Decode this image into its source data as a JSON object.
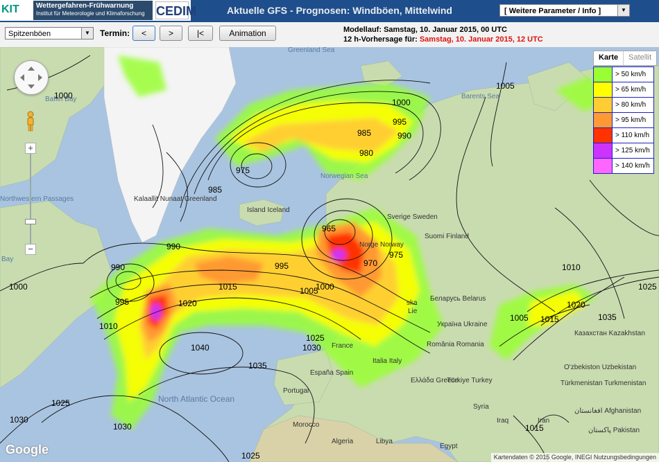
{
  "header": {
    "kit_logo": "KIT",
    "warn_title": "Wettergefahren-Frühwarnung",
    "warn_sub": "Institut für Meteorologie und Klimaforschung",
    "cedim_logo": "CEDIM",
    "title": "Aktuelle GFS - Prognosen: Windböen, Mittelwind",
    "param_select": "[ Weitere Parameter / Info ]"
  },
  "toolbar": {
    "field_select": "Spitzenböen",
    "termin_label": "Termin:",
    "prev_label": "<",
    "next_label": ">",
    "first_label": "|<",
    "animation_label": "Animation",
    "run_prefix": "Modellauf: ",
    "run_value": "Samstag, 10. Januar 2015, 00 UTC",
    "forecast_prefix": "12 h-Vorhersage für: ",
    "forecast_value": "Samstag, 10. Januar 2015, 12 UTC"
  },
  "map": {
    "type_map": "Karte",
    "type_satellite": "Satellit",
    "zoom_in": "+",
    "zoom_out": "−",
    "google": "Google",
    "copyright": "Kartendaten © 2015 Google, INEGI   Nutzungsbedingungen",
    "legend": [
      {
        "label": "> 50 km/h",
        "color": "#99ff33"
      },
      {
        "label": "> 65 km/h",
        "color": "#ffff00"
      },
      {
        "label": "> 80 km/h",
        "color": "#ffcc33"
      },
      {
        "label": "> 95 km/h",
        "color": "#ff9933"
      },
      {
        "label": "> 110 km/h",
        "color": "#ff3300"
      },
      {
        "label": "> 125 km/h",
        "color": "#cc33ff"
      },
      {
        "label": "> 140 km/h",
        "color": "#ff66ff"
      }
    ],
    "place_labels": [
      "Greenland Sea",
      "Baffin Bay",
      "Barents Sea",
      "Norwegian Sea",
      "Kalaallit Nunaat Greenland",
      "Island Iceland",
      "Sverige Sweden",
      "Suomi Finland",
      "Norge Norway",
      "Northwestern Passages",
      "Bay",
      "Беларусь Belarus",
      "Україна Ukraine",
      "France",
      "Italia Italy",
      "España Spain",
      "Portugal",
      "România Romania",
      "Ελλάδα Greece",
      "Türkiye Turkey",
      "Казахстан Kazakhstan",
      "O'zbekiston Uzbekistan",
      "Türkmenistan Turkmenistan",
      "افغانستان Afghanistan",
      "پاکستان Pakistan",
      "Iraq",
      "Iran",
      "Syria",
      "Egypt",
      "Libya",
      "Algeria",
      "Morocco",
      "North Atlantic Ocean",
      "ska",
      "Lie"
    ],
    "isobar_labels": [
      "1000",
      "1005",
      "1000",
      "995",
      "990",
      "985",
      "980",
      "975",
      "985",
      "990",
      "990",
      "995",
      "1000",
      "1010",
      "1020",
      "1015",
      "995",
      "1005",
      "1000",
      "965",
      "970",
      "975",
      "1040",
      "1035",
      "1030",
      "1025",
      "1025",
      "1030",
      "1005",
      "1010",
      "1015",
      "1020",
      "1025",
      "1035",
      "1030",
      "1015",
      "1025"
    ]
  }
}
